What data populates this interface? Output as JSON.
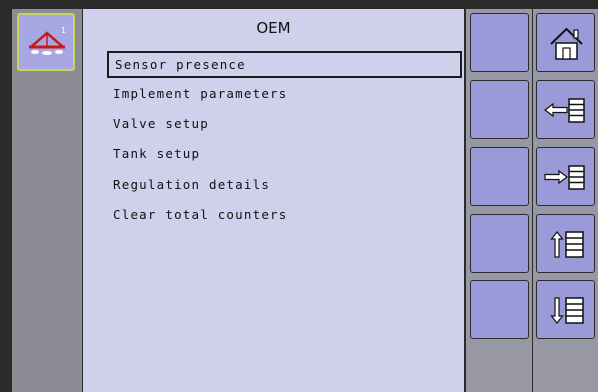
{
  "header": {
    "title": "OEM"
  },
  "menu": {
    "items": [
      {
        "label": "Sensor presence",
        "selected": true
      },
      {
        "label": "Implement parameters",
        "selected": false
      },
      {
        "label": "Valve setup",
        "selected": false
      },
      {
        "label": "Tank setup",
        "selected": false
      },
      {
        "label": "Regulation details",
        "selected": false
      },
      {
        "label": "Clear total counters",
        "selected": false
      }
    ]
  },
  "left_panel": {
    "icon": "sprayer-implement-icon",
    "badge": "1"
  },
  "right_buttons": {
    "column1": [
      "blank",
      "blank",
      "blank",
      "blank",
      "blank"
    ],
    "column2": [
      "home-icon",
      "previous-page-icon",
      "next-page-icon",
      "scroll-up-icon",
      "scroll-down-icon"
    ]
  },
  "colors": {
    "background": "#2b2b2b",
    "menu_bg": "#d0d0ec",
    "button_bg": "#9a9ad8",
    "accent_border": "#c9d35a"
  }
}
